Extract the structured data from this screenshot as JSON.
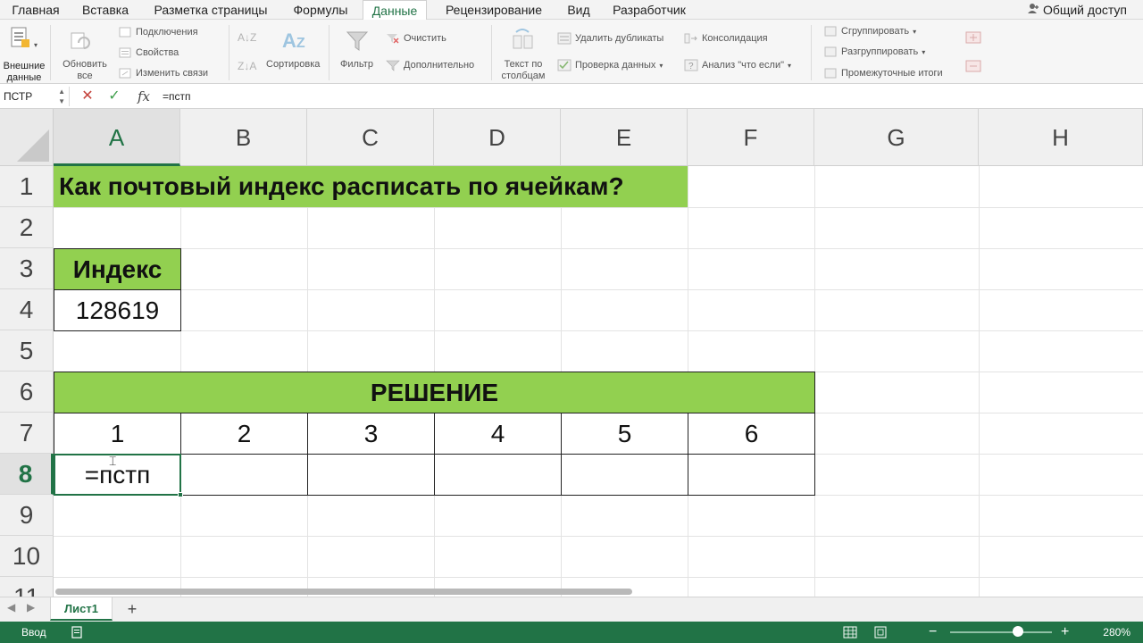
{
  "tabs": [
    "Главная",
    "Вставка",
    "Разметка страницы",
    "Формулы",
    "Данные",
    "Рецензирование",
    "Вид",
    "Разработчик"
  ],
  "active_tab": "Данные",
  "share_label": "Общий доступ",
  "ribbon": {
    "external_data": "Внешние данные",
    "refresh_all": "Обновить все",
    "connections": "Подключения",
    "properties": "Свойства",
    "edit_links": "Изменить связи",
    "sort": "Сортировка",
    "filter": "Фильтр",
    "clear": "Очистить",
    "advanced": "Дополнительно",
    "text_to_columns": "Текст по столбцам",
    "remove_duplicates": "Удалить дубликаты",
    "data_validation": "Проверка данных",
    "consolidate": "Консолидация",
    "what_if": "Анализ \"что если\"",
    "group": "Сгруппировать",
    "ungroup": "Разгруппировать",
    "subtotals": "Промежуточные итоги"
  },
  "formula_bar": {
    "name_box": "ПСТР",
    "fx": "fx",
    "formula": "=пстп"
  },
  "columns": [
    "A",
    "B",
    "C",
    "D",
    "E",
    "F",
    "G",
    "H"
  ],
  "selected_column": "A",
  "rows": [
    "1",
    "2",
    "3",
    "4",
    "5",
    "6",
    "7",
    "8",
    "9",
    "10",
    "11"
  ],
  "selected_row": "8",
  "sheet": {
    "title": "Как почтовый индекс расписать по ячейкам?",
    "index_header": "Индекс",
    "index_value": "128619",
    "solution_header": "РЕШЕНИЕ",
    "digits": [
      "1",
      "2",
      "3",
      "4",
      "5",
      "6"
    ],
    "editing_cell": "=пстп"
  },
  "sheet_tabs": [
    "Лист1"
  ],
  "add_sheet": "+",
  "status": {
    "mode": "Ввод",
    "zoom": "280%",
    "zoom_minus": "−",
    "zoom_plus": "+"
  },
  "colors": {
    "accent": "#217346",
    "header_fill": "#92d050"
  }
}
